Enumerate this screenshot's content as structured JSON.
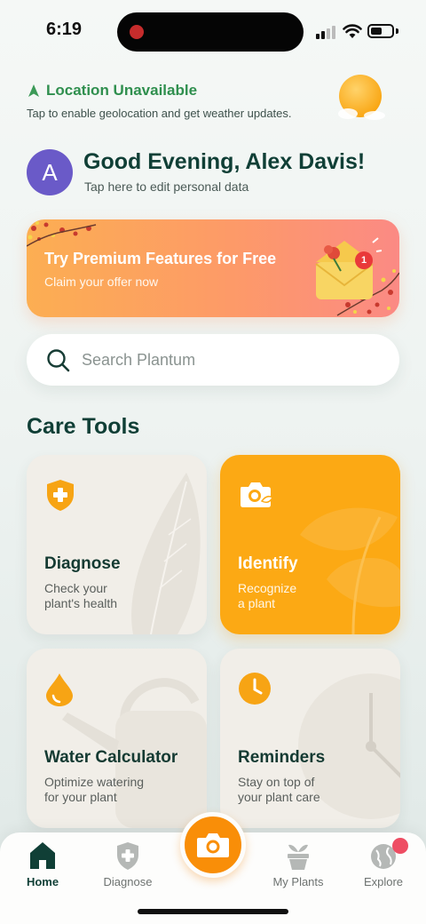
{
  "status_bar": {
    "time": "6:19"
  },
  "location": {
    "title": "Location Unavailable",
    "subtitle": "Tap to enable geolocation and get weather updates.",
    "weather_icon": "sun-icon"
  },
  "greeting": {
    "avatar_initial": "A",
    "title": "Good Evening, Alex Davis!",
    "subtitle": "Tap here to edit personal data"
  },
  "promo": {
    "title": "Try Premium Features for Free",
    "subtitle": "Claim your offer now",
    "badge_count": "1"
  },
  "search": {
    "placeholder": "Search Plantum"
  },
  "care_tools": {
    "title": "Care Tools",
    "cards": [
      {
        "title": "Diagnose",
        "desc_line1": "Check your",
        "desc_line2": "plant's health",
        "icon": "shield-plus-icon"
      },
      {
        "title": "Identify",
        "desc_line1": "Recognize",
        "desc_line2": "a plant",
        "icon": "camera-leaf-icon"
      },
      {
        "title": "Water Calculator",
        "desc_line1": "Optimize watering",
        "desc_line2": "for your plant",
        "icon": "water-drop-icon"
      },
      {
        "title": "Reminders",
        "desc_line1": "Stay on top of",
        "desc_line2": "your plant care",
        "icon": "clock-icon"
      }
    ]
  },
  "tabbar": {
    "items": [
      {
        "label": "Home",
        "icon": "home-icon",
        "active": true
      },
      {
        "label": "Diagnose",
        "icon": "shield-plus-icon"
      },
      {
        "label": "My Plants",
        "icon": "plant-pot-icon"
      },
      {
        "label": "Explore",
        "icon": "globe-icon"
      }
    ],
    "center_icon": "camera-icon"
  },
  "colors": {
    "brand_green": "#103f36",
    "accent_orange": "#fca914",
    "location_green": "#2f8f4e",
    "avatar_purple": "#6a5ac8"
  }
}
